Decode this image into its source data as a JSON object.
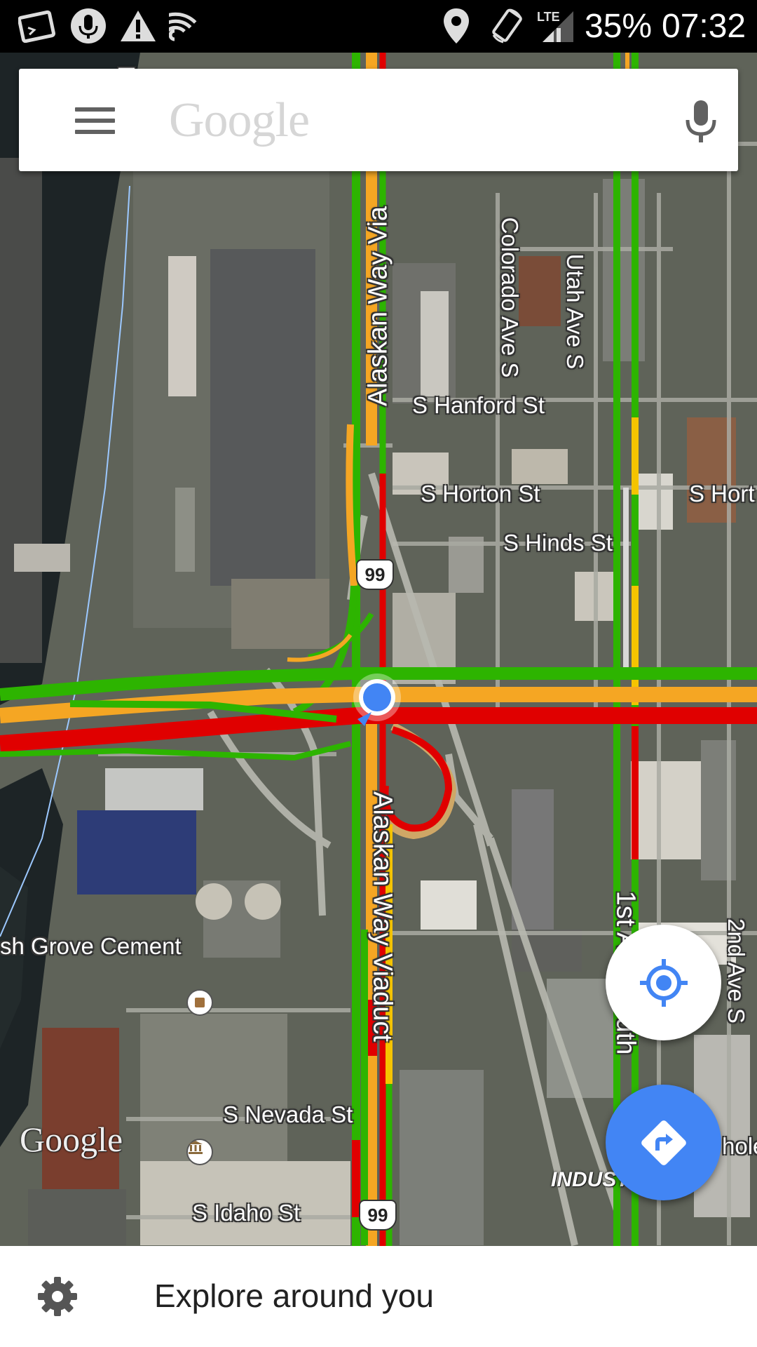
{
  "status_bar": {
    "network_type": "LTE",
    "battery_percent": "35%",
    "time": "07:32",
    "icons": [
      "terminal-icon",
      "microphone-icon",
      "warning-icon",
      "cast-icon",
      "location-pin-icon",
      "screen-rotation-icon",
      "signal-icon"
    ]
  },
  "search": {
    "placeholder": "Google",
    "menu_icon": "hamburger-menu-icon",
    "voice_icon": "microphone-icon"
  },
  "map": {
    "streets": {
      "alaskan_way_viaduct_north": "Alaskan Way Via",
      "alaskan_way_viaduct_south": "Alaskan Way Viaduct",
      "colorado_ave": "Colorado Ave S",
      "utah_ave": "Utah Ave S",
      "hanford": "S Hanford St",
      "horton": "S Horton St",
      "horton_right": "S Hort",
      "hinds": "S Hinds St",
      "first_ave_south": "1st Ave South",
      "second_ave": "2nd Ave S",
      "nevada": "S Nevada St",
      "idaho": "S Idaho St",
      "cement": "sh Grove Cement",
      "right_edge_cut": "hole",
      "partial_top": "Ds"
    },
    "route_shield_top": "99",
    "route_shield_bottom": "99",
    "district": "INDUSTRIAL",
    "watermark": "Google",
    "traffic_colors": {
      "heavy": "#e00000",
      "moderate": "#f5a623",
      "free": "#2db400"
    },
    "my_location_color": "#4285f4"
  },
  "fab": {
    "locate_icon": "my-location-icon",
    "directions_icon": "directions-icon",
    "directions_color": "#4285f4"
  },
  "explore": {
    "label": "Explore around you",
    "icon": "settings-gear-icon"
  }
}
